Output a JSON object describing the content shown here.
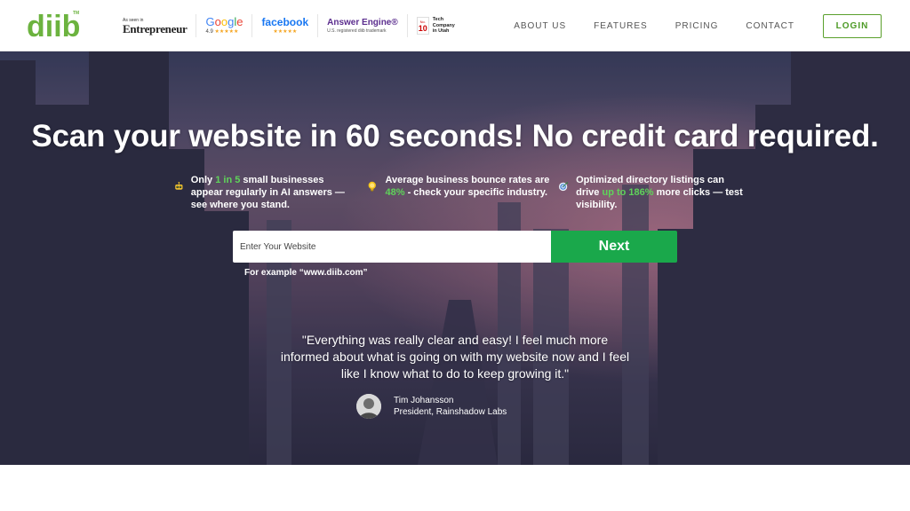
{
  "brand": {
    "logo_text": "diib",
    "trademark": "TM",
    "accent": "#6cb33f"
  },
  "press": {
    "entrepreneur": {
      "small": "As seen in",
      "name": "Entrepreneur"
    },
    "google": {
      "name": "Google",
      "rating": "4.9",
      "stars": "★★★★★"
    },
    "facebook": {
      "name": "facebook",
      "stars": "★★★★★"
    },
    "answer_engine": {
      "name": "Answer Engine®",
      "sub": "U.S. registered diib trademark"
    },
    "tech": {
      "no": "No.",
      "rank": "10",
      "line1": "Tech",
      "line2": "Company",
      "line3": "in Utah"
    }
  },
  "nav": {
    "items": [
      "ABOUT US",
      "FEATURES",
      "PRICING",
      "CONTACT"
    ],
    "login": "LOGIN"
  },
  "hero": {
    "headline": "Scan your website in 60 seconds! No credit card required.",
    "features": [
      {
        "icon": "robot-icon",
        "pre": "Only ",
        "highlight": "1 in 5",
        "post": " small businesses appear regularly in AI answers — see where you stand."
      },
      {
        "icon": "lightbulb-icon",
        "pre": "Average business bounce rates are ",
        "highlight": "48%",
        "post": " - check your specific industry."
      },
      {
        "icon": "target-icon",
        "pre": "Optimized directory listings can drive ",
        "highlight": "up to 186%",
        "post": " more clicks — test visibility."
      }
    ],
    "search": {
      "placeholder": "Enter Your Website",
      "button": "Next",
      "example": "For example “www.diib.com”"
    },
    "testimonial": {
      "quote": "\"Everything was really clear and easy! I feel much more informed about what is going on with my website now and I feel like I know what to do to keep growing it.\"",
      "name": "Tim Johansson",
      "title": "President, Rainshadow Labs"
    },
    "colors": {
      "highlight": "#5fd35a",
      "button": "#1aa84b"
    }
  }
}
